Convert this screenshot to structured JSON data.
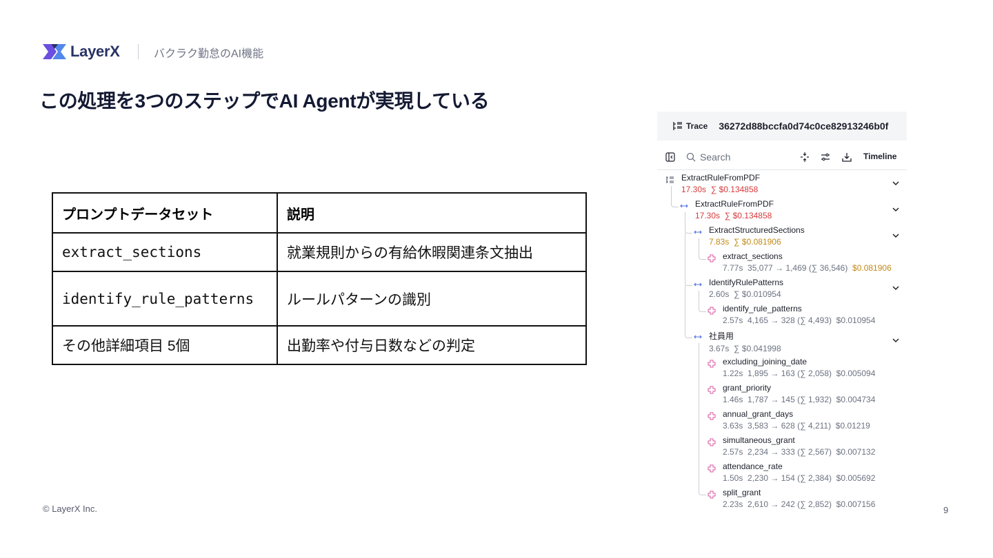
{
  "header": {
    "brand": "LayerX",
    "subtitle": "バクラク勤怠のAI機能",
    "title": "この処理を3つのステップでAI Agentが実現している"
  },
  "table": {
    "headers": [
      "プロンプトデータセット",
      "説明"
    ],
    "rows": [
      {
        "dataset": "extract_sections",
        "description": "就業規則からの有給休暇関連条文抽出"
      },
      {
        "dataset": "identify_rule_patterns",
        "description": "ルールパターンの識別"
      },
      {
        "dataset": "その他詳細項目 5個",
        "description": "出勤率や付与日数などの判定"
      }
    ]
  },
  "footer": {
    "copyright": "© LayerX Inc.",
    "page_number": "9"
  },
  "trace": {
    "label": "Trace",
    "id": "36272d88bccfa0d74c0ce82913246b0f",
    "search_placeholder": "Search",
    "timeline_label": "Timeline",
    "nodes": [
      {
        "name": "ExtractRuleFromPDF",
        "time": "17.30s",
        "cost": "∑ $0.134858",
        "tokens": "",
        "cost2": ""
      },
      {
        "name": "ExtractRuleFromPDF",
        "time": "17.30s",
        "cost": "∑ $0.134858",
        "tokens": "",
        "cost2": ""
      },
      {
        "name": "ExtractStructuredSections",
        "time": "7.83s",
        "cost": "∑ $0.081906",
        "tokens": "",
        "cost2": ""
      },
      {
        "name": "extract_sections",
        "time": "7.77s",
        "cost": "",
        "tokens": "35,077 → 1,469 (∑ 36,546)",
        "cost2": "$0.081906"
      },
      {
        "name": "IdentifyRulePatterns",
        "time": "2.60s",
        "cost": "∑ $0.010954",
        "tokens": "",
        "cost2": ""
      },
      {
        "name": "identify_rule_patterns",
        "time": "2.57s",
        "cost": "",
        "tokens": "4,165 → 328 (∑ 4,493)",
        "cost2": "$0.010954"
      },
      {
        "name": "社員用",
        "time": "3.67s",
        "cost": "∑ $0.041998",
        "tokens": "",
        "cost2": ""
      },
      {
        "name": "excluding_joining_date",
        "time": "1.22s",
        "cost": "",
        "tokens": "1,895 → 163 (∑ 2,058)",
        "cost2": "$0.005094"
      },
      {
        "name": "grant_priority",
        "time": "1.46s",
        "cost": "",
        "tokens": "1,787 → 145 (∑ 1,932)",
        "cost2": "$0.004734"
      },
      {
        "name": "annual_grant_days",
        "time": "3.63s",
        "cost": "",
        "tokens": "3,583 → 628 (∑ 4,211)",
        "cost2": "$0.01219"
      },
      {
        "name": "simultaneous_grant",
        "time": "2.57s",
        "cost": "",
        "tokens": "2,234 → 333 (∑ 2,567)",
        "cost2": "$0.007132"
      },
      {
        "name": "attendance_rate",
        "time": "1.50s",
        "cost": "",
        "tokens": "2,230 → 154 (∑ 2,384)",
        "cost2": "$0.005692"
      },
      {
        "name": "split_grant",
        "time": "2.23s",
        "cost": "",
        "tokens": "2,610 → 242 (∑ 2,852)",
        "cost2": "$0.007156"
      }
    ]
  },
  "colors": {
    "accent_green": "#1a7f3a",
    "trace_red": "#d6393b",
    "trace_amber": "#c08a16",
    "span_icon_blue": "#4f6fe0",
    "generation_icon_pink": "#d9559f",
    "brand_navy": "#283266"
  }
}
